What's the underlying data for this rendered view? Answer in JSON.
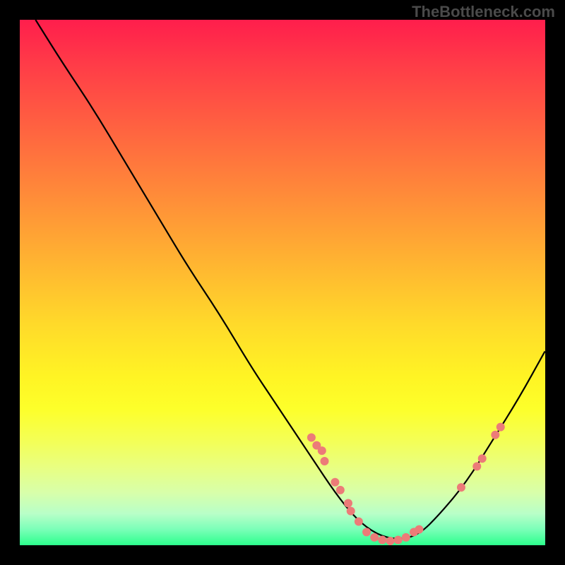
{
  "watermark": "TheBottleneck.com",
  "chart_data": {
    "type": "line",
    "title": "",
    "xlabel": "",
    "ylabel": "",
    "xlim": [
      0,
      100
    ],
    "ylim": [
      0,
      100
    ],
    "grid": false,
    "series": [
      {
        "name": "curve",
        "color": "#000000",
        "x": [
          3,
          8,
          14,
          20,
          26,
          32,
          38,
          44,
          48,
          52,
          56,
          60,
          64,
          68,
          72,
          76,
          80,
          85,
          90,
          95,
          100
        ],
        "y": [
          100,
          92,
          83,
          73,
          63,
          53,
          44,
          34,
          28,
          22,
          16,
          10,
          5,
          2,
          1,
          2,
          6,
          12,
          20,
          28,
          37
        ]
      }
    ],
    "scatter_points": {
      "name": "dots",
      "color": "#ec7b78",
      "radius": 6,
      "points": [
        {
          "x": 55.5,
          "y": 20.5
        },
        {
          "x": 56.5,
          "y": 19.0
        },
        {
          "x": 57.5,
          "y": 18.0
        },
        {
          "x": 58.0,
          "y": 16.0
        },
        {
          "x": 60.0,
          "y": 12.0
        },
        {
          "x": 61.0,
          "y": 10.5
        },
        {
          "x": 62.5,
          "y": 8.0
        },
        {
          "x": 63.0,
          "y": 6.5
        },
        {
          "x": 64.5,
          "y": 4.5
        },
        {
          "x": 66.0,
          "y": 2.5
        },
        {
          "x": 67.5,
          "y": 1.5
        },
        {
          "x": 69.0,
          "y": 1.0
        },
        {
          "x": 70.5,
          "y": 0.8
        },
        {
          "x": 72.0,
          "y": 1.0
        },
        {
          "x": 73.5,
          "y": 1.5
        },
        {
          "x": 75.0,
          "y": 2.5
        },
        {
          "x": 76.0,
          "y": 3.0
        },
        {
          "x": 84.0,
          "y": 11.0
        },
        {
          "x": 87.0,
          "y": 15.0
        },
        {
          "x": 88.0,
          "y": 16.5
        },
        {
          "x": 90.5,
          "y": 21.0
        },
        {
          "x": 91.5,
          "y": 22.5
        }
      ]
    },
    "background_gradient": {
      "top": "#ff1e4c",
      "middle": "#ffda2a",
      "bottom": "#2cff8c"
    }
  }
}
